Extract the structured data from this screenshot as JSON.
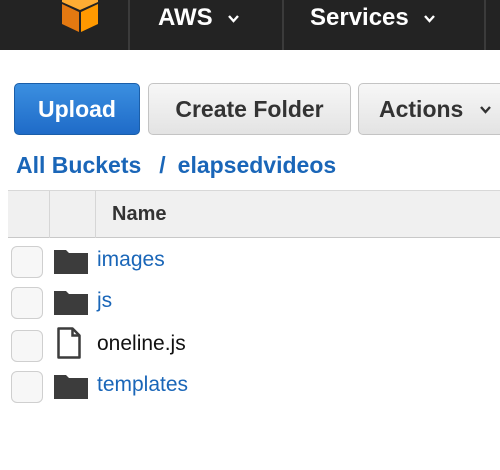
{
  "nav": {
    "logo_icon": "aws-cube-icon",
    "items": [
      {
        "label": "AWS"
      },
      {
        "label": "Services"
      }
    ]
  },
  "toolbar": {
    "upload_label": "Upload",
    "create_folder_label": "Create Folder",
    "actions_label": "Actions"
  },
  "breadcrumb": {
    "root": "All Buckets",
    "separator": "/",
    "current": "elapsedvideos"
  },
  "table": {
    "columns": [
      "Name"
    ],
    "rows": [
      {
        "name": "images",
        "type": "folder",
        "icon": "folder-icon"
      },
      {
        "name": "js",
        "type": "folder",
        "icon": "folder-icon"
      },
      {
        "name": "oneline.js",
        "type": "file",
        "icon": "file-icon"
      },
      {
        "name": "templates",
        "type": "folder",
        "icon": "folder-icon"
      }
    ]
  },
  "colors": {
    "topbar": "#232323",
    "accent": "#f90",
    "link": "#1a66b8",
    "primary_button": "#1f6bc8"
  }
}
